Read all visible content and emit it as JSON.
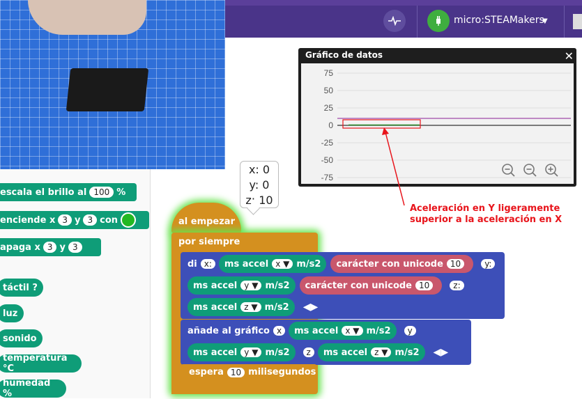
{
  "header": {
    "device_name": "micro:STEAMakers"
  },
  "colors": {
    "header": "#4a3489",
    "motion_teal": "#0f9d78",
    "control_orange": "#d4901f",
    "looks_blue": "#3d4fb8",
    "unicode_pink": "#c9576c",
    "annotation_red": "#e8141b",
    "glow_green": "#66e34d"
  },
  "palette": {
    "blocks": [
      {
        "text": "escala el brillo al",
        "value": "100",
        "suffix": "%"
      },
      {
        "text": "enciende x",
        "x": "3",
        "y_label": "y",
        "y": "3",
        "suffix": "con"
      },
      {
        "text": "apaga x",
        "x": "3",
        "y_label": "y",
        "y": "3"
      }
    ],
    "reporters": [
      "táctil ?",
      "luz",
      "sonido",
      "temperatura °C",
      "humedad %"
    ]
  },
  "speech_bubble": {
    "line1": "x: 0",
    "line2": "y: 0",
    "line3": "z: 10"
  },
  "chart_window": {
    "title": "Gráfico de datos",
    "close_icon": "close-icon",
    "zoom_icons": [
      "zoom-out-icon",
      "zoom-reset-icon",
      "zoom-in-icon"
    ]
  },
  "chart_data": {
    "type": "line",
    "ylim": [
      -80,
      85
    ],
    "yticks": [
      "75",
      "50",
      "25",
      "0",
      "-25",
      "-50",
      "-75"
    ],
    "series": [
      {
        "color": "#a04aa8",
        "values": [
          10,
          10,
          10,
          10,
          10,
          10,
          10,
          10,
          10,
          10
        ]
      },
      {
        "color": "#333333",
        "values": [
          0,
          0,
          0,
          0,
          0,
          0,
          0,
          0,
          0,
          0
        ]
      },
      {
        "color": "#2a8a2a",
        "values": [
          0.5,
          0.5,
          0.5,
          0.5,
          0.5
        ]
      }
    ],
    "grid": true
  },
  "annotation": {
    "line1": "Aceleración en Y ligeramente",
    "line2": "superior a la aceleración en X"
  },
  "script": {
    "hat_label": "al empezar",
    "forever_label": "por siempre",
    "say": {
      "label": "di",
      "x_text": "x:",
      "r1": {
        "pre": "ms accel",
        "axis": "x",
        "post": "m/s2"
      },
      "u1": {
        "label": "carácter con unicode",
        "value": "10"
      },
      "y_text": "y:",
      "r2": {
        "pre": "ms accel",
        "axis": "y",
        "post": "m/s2"
      },
      "u2": {
        "label": "carácter con unicode",
        "value": "10"
      },
      "z_text": "z:",
      "r3": {
        "pre": "ms accel",
        "axis": "z",
        "post": "m/s2"
      }
    },
    "plot": {
      "label": "añade al gráfico",
      "x_text": "x",
      "r1": {
        "pre": "ms accel",
        "axis": "x",
        "post": "m/s2"
      },
      "y_text": "y",
      "r2": {
        "pre": "ms accel",
        "axis": "y",
        "post": "m/s2"
      },
      "z_text": "z",
      "r3": {
        "pre": "ms accel",
        "axis": "z",
        "post": "m/s2"
      }
    },
    "wait": {
      "label": "espera",
      "value": "10",
      "suffix": "milisegundos"
    }
  }
}
